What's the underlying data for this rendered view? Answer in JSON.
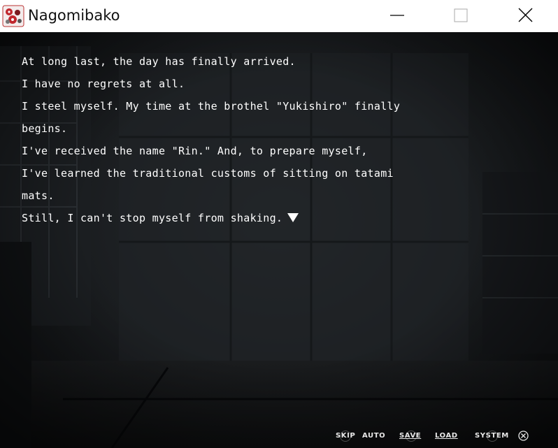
{
  "window": {
    "title": "Nagomibako"
  },
  "icons": {
    "app": "nagomibako-app-icon",
    "minimize": "minimize-icon",
    "maximize": "maximize-icon",
    "close": "close-icon",
    "next": "next-page-triangle-icon",
    "menu_close": "circle-x-icon"
  },
  "dialogue": {
    "lines": [
      "At long last, the day has finally arrived.",
      "I have no regrets at all.",
      "I steel myself. My time at the brothel \"Yukishiro\" finally",
      "begins.",
      "I've received the name \"Rin.\" And, to prepare myself,",
      "I've learned the traditional customs of sitting on tatami",
      "mats.",
      "Still, I can't stop myself from shaking."
    ]
  },
  "menu": {
    "skip": "SKIP",
    "auto": "AUTO",
    "save": "SAVE",
    "load": "LOAD",
    "system": "SYSTEM"
  },
  "colors": {
    "text": "#ffffff",
    "menu_text": "#e8e8e8",
    "scene_bg": "#1d2023",
    "titlebar": "#ffffff"
  }
}
